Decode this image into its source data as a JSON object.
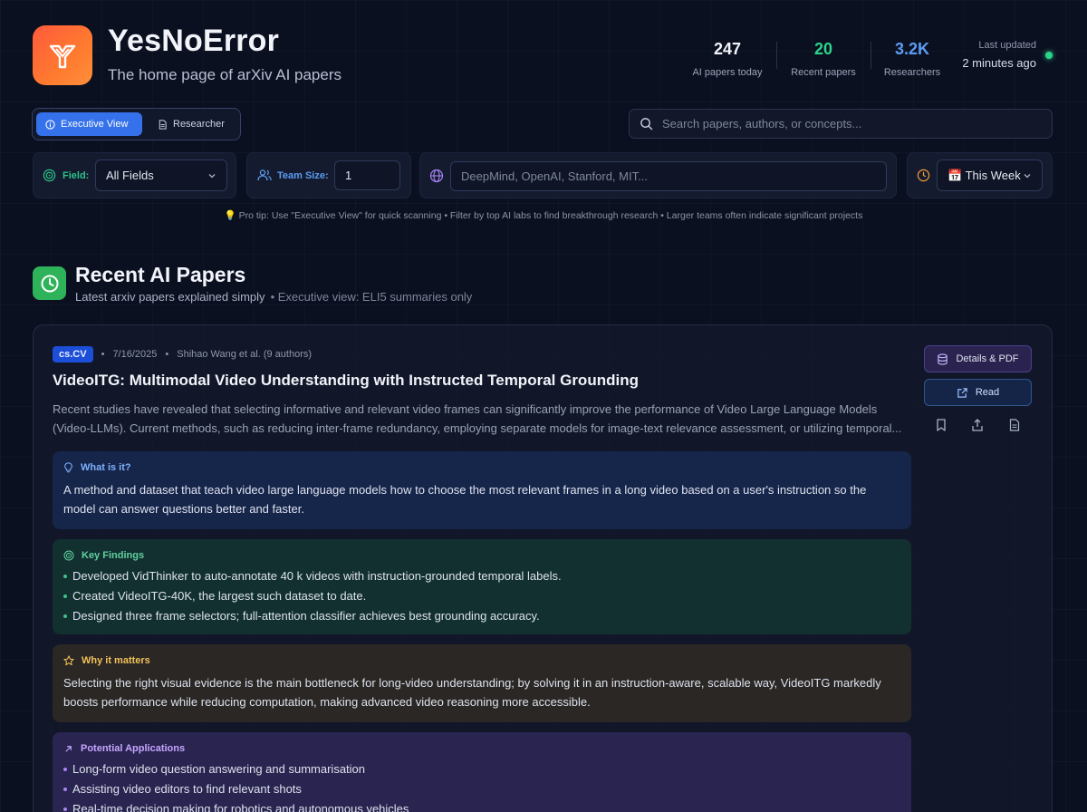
{
  "app": {
    "title": "YesNoError",
    "subtitle": "The home page of arXiv AI papers"
  },
  "stats": [
    {
      "value": "247",
      "label": "AI papers today",
      "color": "#f2f4fa"
    },
    {
      "value": "20",
      "label": "Recent papers",
      "color": "#2bd48a"
    },
    {
      "value": "3.2K",
      "label": "Researchers",
      "color": "#5b9cf2"
    }
  ],
  "updated": {
    "label": "Last updated",
    "value": "2 minutes ago"
  },
  "view_toggle": {
    "executive": "Executive View",
    "researcher": "Researcher"
  },
  "search": {
    "placeholder": "Search papers, authors, or concepts..."
  },
  "filters": {
    "field_label": "Field:",
    "field_value": "All Fields",
    "team_label": "Team Size:",
    "team_value": "1",
    "org_placeholder": "DeepMind, OpenAI, Stanford, MIT...",
    "period_value": "📅 This Week"
  },
  "tip": "💡 Pro tip: Use \"Executive View\" for quick scanning • Filter by top AI labs to find breakthrough research • Larger teams often indicate significant projects",
  "section": {
    "title": "Recent AI Papers",
    "subtitle": "Latest arxiv papers explained simply",
    "mode_note": "• Executive view: ELI5 summaries only"
  },
  "paper": {
    "tag": "cs.CV",
    "date": "7/16/2025",
    "authors": "Shihao Wang et al. (9 authors)",
    "title": "VideoITG: Multimodal Video Understanding with Instructed Temporal Grounding",
    "abstract_line1": "Recent studies have revealed that selecting informative and relevant video frames can significantly improve the performance of Video Large Language Models",
    "abstract_line2": "(Video-LLMs). Current methods, such as reducing inter-frame redundancy, employing separate models for image-text relevance assessment, or utilizing temporal...",
    "details_label": "Details & PDF",
    "read_label": "Read",
    "what_head": "What is it?",
    "what_text": "A method and dataset that teach video large language models how to choose the most relevant frames in a long video based on a user's instruction so the model can answer questions better and faster.",
    "key_head": "Key Findings",
    "key_findings": [
      "Developed VidThinker to auto-annotate 40 k videos with instruction-grounded temporal labels.",
      "Created VideoITG-40K, the largest such dataset to date.",
      "Designed three frame selectors; full-attention classifier achieves best grounding accuracy."
    ],
    "why_head": "Why it matters",
    "why_text": "Selecting the right visual evidence is the main bottleneck for long-video understanding; by solving it in an instruction-aware, scalable way, VideoITG markedly boosts performance while reducing computation, making advanced video reasoning more accessible.",
    "app_head": "Potential Applications",
    "applications": [
      "Long-form video question answering and summarisation",
      "Assisting video editors to find relevant shots",
      "Real-time decision making for robotics and autonomous vehicles"
    ]
  }
}
